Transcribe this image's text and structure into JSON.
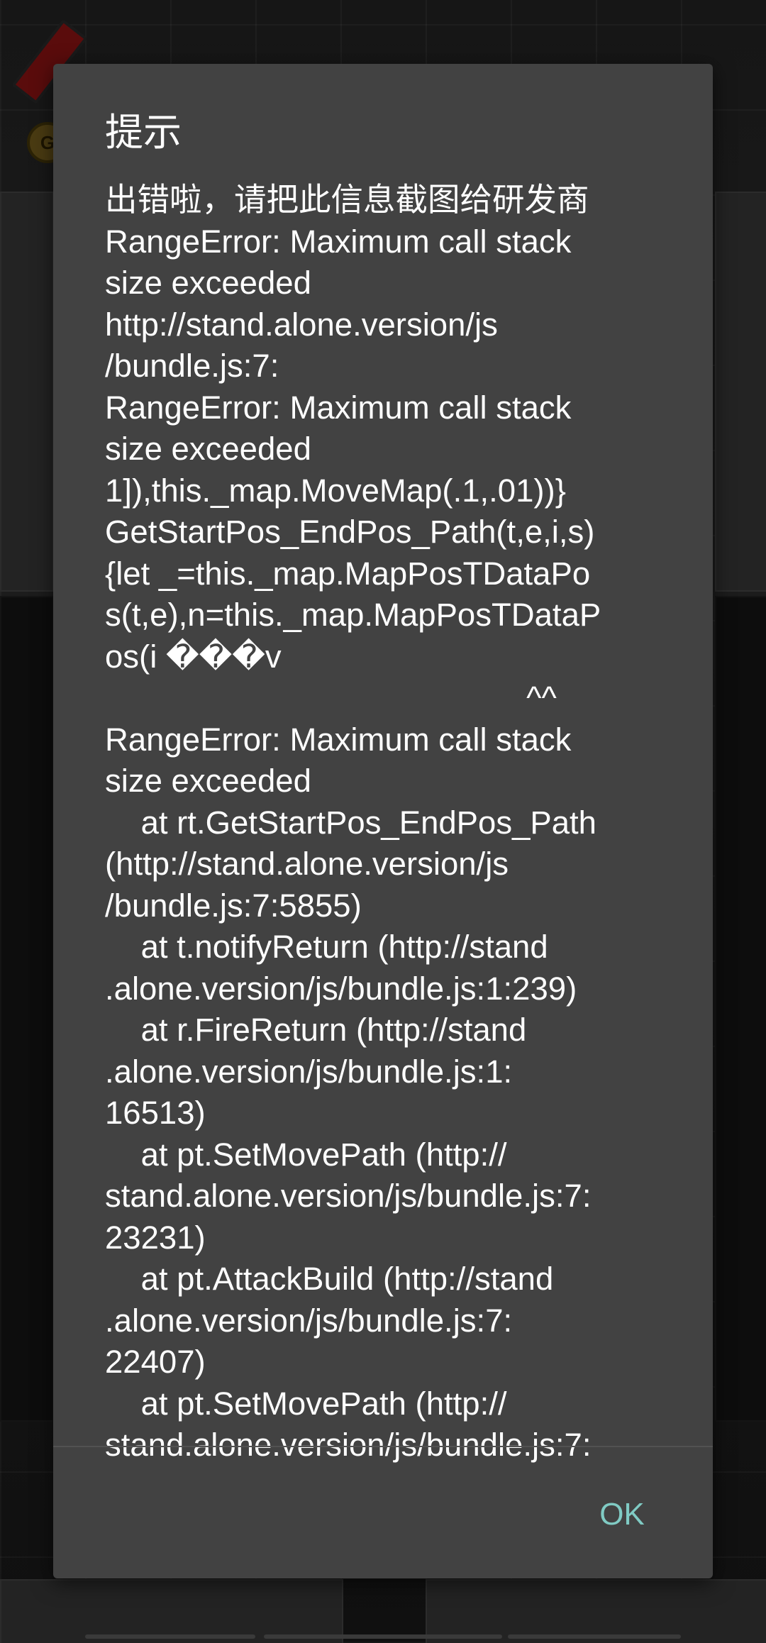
{
  "dialog": {
    "title": "提示",
    "message": "出错啦，请把此信息截图给研发商\nRangeError: Maximum call stack\nsize exceeded\nhttp://stand.alone.version/js\n/bundle.js:7:\nRangeError: Maximum call stack\nsize exceeded\n1]),this._map.MoveMap(.1,.01))}\nGetStartPos_EndPos_Path(t,e,i,s)\n{let _=this._map.MapPosTDataPo\ns(t,e),n=this._map.MapPosTDataP\nos(i ���v\n                                               ^^\nRangeError: Maximum call stack\nsize exceeded\n    at rt.GetStartPos_EndPos_Path\n(http://stand.alone.version/js\n/bundle.js:7:5855)\n    at t.notifyReturn (http://stand\n.alone.version/js/bundle.js:1:239)\n    at r.FireReturn (http://stand\n.alone.version/js/bundle.js:1:\n16513)\n    at pt.SetMovePath (http://\nstand.alone.version/js/bundle.js:7:\n23231)\n    at pt.AttackBuild (http://stand\n.alone.version/js/bundle.js:7:\n22407)\n    at pt.SetMovePath (http://\nstand.alone.version/js/bundle.js:7:",
    "ok_label": "OK"
  },
  "background": {
    "coin_glyph": "G"
  },
  "colors": {
    "dialog_bg": "#424242",
    "accent": "#80cbc4",
    "text": "#ffffff"
  }
}
